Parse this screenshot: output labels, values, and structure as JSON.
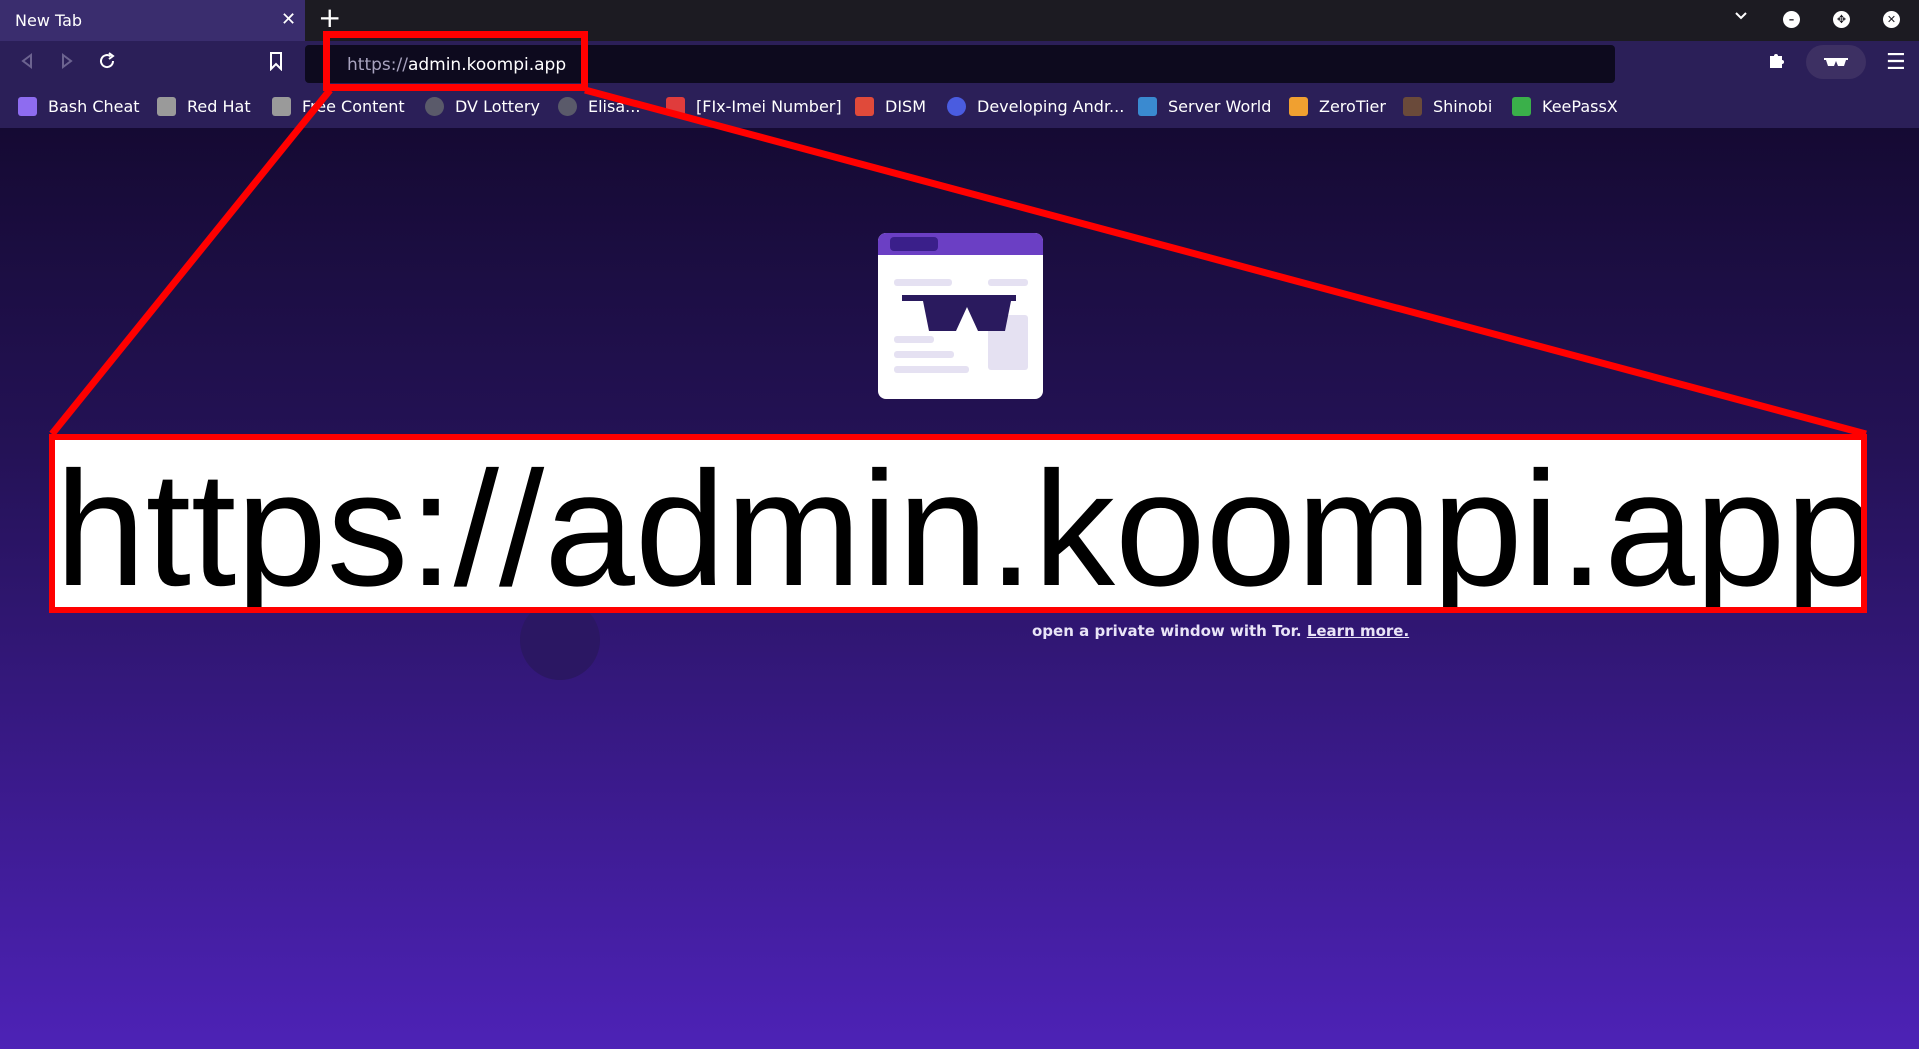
{
  "tab": {
    "title": "New Tab",
    "close": "✕"
  },
  "toolbar": {
    "new_tab": "+",
    "tab_list": "⌄",
    "menu": "☰",
    "extensions": "🧩"
  },
  "url": {
    "scheme": "https://",
    "host": "admin.koompi.app",
    "full": "https://admin.koompi.app"
  },
  "bookmarks": [
    {
      "label": "Bash Cheat",
      "icon": "#8e6cf0"
    },
    {
      "label": "Red Hat",
      "icon": "#9a9a9a"
    },
    {
      "label": "Free Content",
      "icon": "#9a9a9a"
    },
    {
      "label": "DV Lottery",
      "icon": "#5a5a6a"
    },
    {
      "label": "Elisa...",
      "icon": "#5a5a6a"
    },
    {
      "label": "[FIx-Imei Number]",
      "icon": "#e03c3c"
    },
    {
      "label": "DISM",
      "icon": "#e04a3a"
    },
    {
      "label": "Developing Andr...",
      "icon": "#4a5ce0"
    },
    {
      "label": "Server World",
      "icon": "#3a8ad0"
    },
    {
      "label": "ZeroTier",
      "icon": "#f0a030"
    },
    {
      "label": "Shinobi",
      "icon": "#6a4a3a"
    },
    {
      "label": "KeePassX",
      "icon": "#3ab04a"
    }
  ],
  "content": {
    "private_text": "open a private window with Tor.",
    "learn_more": "Learn more."
  }
}
